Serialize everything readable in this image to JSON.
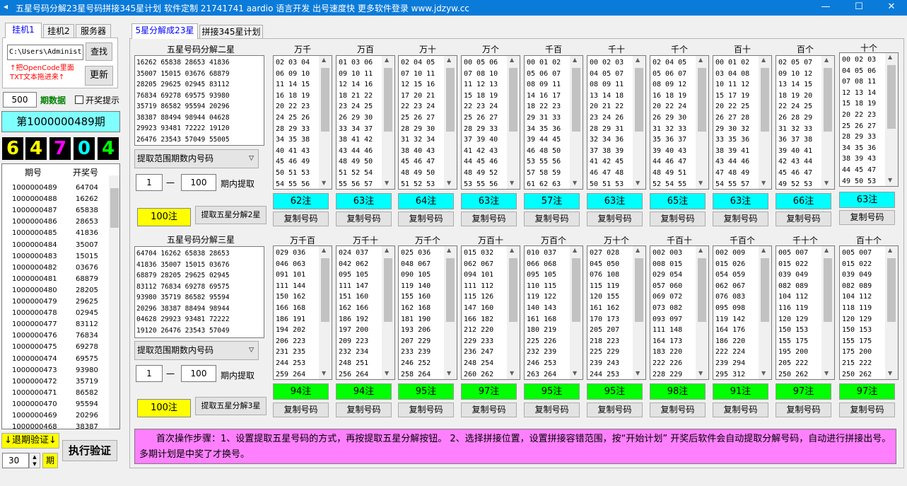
{
  "window": {
    "title": "五星号码分解23星号码拼接345星计划 软件定制 21741741 aardio 语言开发 出号速度快 更多软件登录 www.jdzyw.cc",
    "min": "—",
    "max": "☐",
    "close": "✕",
    "icon": "app-icon"
  },
  "left_tabs": [
    "挂机1",
    "挂机2",
    "服务器"
  ],
  "path_input": "C:\\Users\\Administ",
  "view_btn": "查找",
  "drag_hint_1": "↑把OpenCode里面",
  "drag_hint_2": "TXT文本拖进来↑",
  "refresh_btn": "更新",
  "period_count": "500",
  "period_count_label": "期数据",
  "prize_hint": "开奖提示",
  "current_period": "第1000000489期",
  "balls": [
    "6",
    "4",
    "7",
    "0",
    "4"
  ],
  "ball_colors": [
    "#ffff00",
    "#ffff00",
    "#ff00ff",
    "#00ffff",
    "#00ff00"
  ],
  "history": {
    "headers": [
      "期号",
      "开奖号"
    ],
    "rows": [
      [
        "1000000489",
        "64704"
      ],
      [
        "1000000488",
        "16262"
      ],
      [
        "1000000487",
        "65838"
      ],
      [
        "1000000486",
        "28653"
      ],
      [
        "1000000485",
        "41836"
      ],
      [
        "1000000484",
        "35007"
      ],
      [
        "1000000483",
        "15015"
      ],
      [
        "1000000482",
        "03676"
      ],
      [
        "1000000481",
        "68879"
      ],
      [
        "1000000480",
        "28205"
      ],
      [
        "1000000479",
        "29625"
      ],
      [
        "1000000478",
        "02945"
      ],
      [
        "1000000477",
        "83112"
      ],
      [
        "1000000476",
        "76834"
      ],
      [
        "1000000475",
        "69278"
      ],
      [
        "1000000474",
        "69575"
      ],
      [
        "1000000473",
        "93980"
      ],
      [
        "1000000472",
        "35719"
      ],
      [
        "1000000471",
        "86582"
      ],
      [
        "1000000470",
        "95594"
      ],
      [
        "1000000469",
        "20296"
      ],
      [
        "1000000468",
        "38387"
      ]
    ]
  },
  "verify_step_btn": "↓退期验证↓",
  "verify_value": "30",
  "verify_unit": "期",
  "exec_verify_btn": "执行验证",
  "main_tabs": [
    "5星分解成23星",
    "拼接345星计划"
  ],
  "sec2": {
    "title": "五星号码分解二星",
    "lines": [
      "16262 65838 28653 41836",
      "35007 15015 03676 68879",
      "28205 29625 02945 83112",
      "76834 69278 69575 93980",
      "35719 86582 95594 20296",
      "38387 88494 98944 04628",
      "29923 93481 72222 19120",
      "26476 23543 57049 55005"
    ],
    "mode": "提取范围期数内号码",
    "from": "1",
    "to": "100",
    "sep": "一",
    "range_label": "期内提取",
    "count": "100注",
    "action": "提取五星分解2星",
    "columns": [
      {
        "h": "万千",
        "l": [
          "02 03 04",
          "06 09 10",
          "11 14 15",
          "16 18 19",
          "20 22 23",
          "24 25 26",
          "28 29 33",
          "34 35 38",
          "40 41 43",
          "45 46 49",
          "50 51 53",
          "54 55 56"
        ],
        "c": "62注"
      },
      {
        "h": "万百",
        "l": [
          "01 03 06",
          "09 10 11",
          "12 14 16",
          "18 21 22",
          "23 24 25",
          "26 29 30",
          "33 34 37",
          "38 41 42",
          "43 44 46",
          "48 49 50",
          "51 52 54",
          "55 56 57"
        ],
        "c": "63注"
      },
      {
        "h": "万十",
        "l": [
          "02 04 05",
          "07 10 11",
          "12 15 16",
          "17 20 21",
          "22 23 24",
          "25 26 27",
          "28 29 30",
          "31 32 34",
          "38 40 43",
          "45 46 47",
          "48 49 50",
          "51 52 53"
        ],
        "c": "64注"
      },
      {
        "h": "万个",
        "l": [
          "00 05 06",
          "07 08 10",
          "11 12 13",
          "15 18 19",
          "22 23 24",
          "25 26 27",
          "28 29 33",
          "37 39 40",
          "41 42 43",
          "44 45 46",
          "48 49 52",
          "53 55 56"
        ],
        "c": "63注"
      },
      {
        "h": "千百",
        "l": [
          "00 01 02",
          "05 06 07",
          "08 09 11",
          "14 16 17",
          "18 22 23",
          "29 31 33",
          "34 35 36",
          "39 44 45",
          "46 48 50",
          "53 55 56",
          "57 58 59",
          "61 62 63"
        ],
        "c": "57注"
      },
      {
        "h": "千十",
        "l": [
          "00 02 03",
          "04 05 07",
          "08 09 11",
          "13 14 18",
          "20 21 22",
          "23 24 26",
          "28 29 31",
          "32 34 36",
          "37 38 39",
          "41 42 45",
          "46 47 48",
          "50 51 53"
        ],
        "c": "63注"
      },
      {
        "h": "千个",
        "l": [
          "02 04 05",
          "05 06 07",
          "08 09 12",
          "16 18 19",
          "20 22 24",
          "26 29 30",
          "31 32 33",
          "35 36 37",
          "39 40 43",
          "44 46 47",
          "48 49 51",
          "52 54 55"
        ],
        "c": "65注"
      },
      {
        "h": "百十",
        "l": [
          "00 01 02",
          "03 04 08",
          "10 11 12",
          "15 17 19",
          "20 22 25",
          "26 27 28",
          "29 30 32",
          "33 35 36",
          "38 39 41",
          "43 44 46",
          "47 48 49",
          "54 55 57"
        ],
        "c": "63注"
      },
      {
        "h": "百个",
        "l": [
          "02 05 07",
          "09 10 12",
          "13 14 15",
          "18 19 20",
          "22 24 25",
          "26 28 29",
          "31 32 33",
          "36 37 38",
          "39 40 41",
          "42 43 44",
          "45 46 47",
          "49 52 53"
        ],
        "c": "66注"
      },
      {
        "h": "十个",
        "l": [
          "00 02 03",
          "04 05 06",
          "07 08 11",
          "12 13 14",
          "15 18 19",
          "20 22 23",
          "25 26 27",
          "28 29 33",
          "34 35 36",
          "38 39 43",
          "44 45 47",
          "49 50 53"
        ],
        "c": "63注"
      }
    ]
  },
  "sec3": {
    "title": "五星号码分解三星",
    "lines": [
      "64704 16262 65838 28653",
      "41836 35007 15015 03676",
      "68879 28205 29625 02945",
      "83112 76834 69278 69575",
      "93980 35719 86582 95594",
      "20296 38387 88494 98944",
      "04628 29923 93481 72222",
      "19120 26476 23543 57049"
    ],
    "mode": "提取范围期数内号码",
    "from": "1",
    "to": "100",
    "sep": "一",
    "range_label": "期内提取",
    "count": "100注",
    "action": "提取五星分解3星",
    "columns": [
      {
        "h": "万千百",
        "l": [
          "029 036",
          "046 063",
          "091 101",
          "111 144",
          "150 162",
          "166 168",
          "186 191",
          "194 202",
          "206 223",
          "231 235",
          "244 253",
          "259 264"
        ],
        "c": "94注"
      },
      {
        "h": "万千十",
        "l": [
          "024 037",
          "042 062",
          "095 105",
          "111 147",
          "151 160",
          "162 166",
          "186 192",
          "197 200",
          "209 223",
          "232 234",
          "248 251",
          "256 264"
        ],
        "c": "94注"
      },
      {
        "h": "万千个",
        "l": [
          "025 036",
          "048 067",
          "090 105",
          "119 140",
          "155 160",
          "162 168",
          "181 190",
          "193 206",
          "207 229",
          "233 239",
          "246 252",
          "258 264"
        ],
        "c": "95注"
      },
      {
        "h": "万百十",
        "l": [
          "015 032",
          "062 067",
          "094 101",
          "111 112",
          "115 126",
          "147 160",
          "166 182",
          "212 220",
          "229 233",
          "236 247",
          "248 254",
          "260 262"
        ],
        "c": "97注"
      },
      {
        "h": "万百个",
        "l": [
          "010 037",
          "066 068",
          "095 105",
          "110 115",
          "119 122",
          "140 143",
          "161 168",
          "180 219",
          "225 226",
          "232 239",
          "246 253",
          "263 264"
        ],
        "c": "95注"
      },
      {
        "h": "万十个",
        "l": [
          "027 028",
          "045 050",
          "076 108",
          "115 119",
          "120 155",
          "161 162",
          "170 173",
          "205 207",
          "218 223",
          "225 229",
          "239 243",
          "244 253"
        ],
        "c": "95注"
      },
      {
        "h": "千百十",
        "l": [
          "002 003",
          "008 015",
          "029 054",
          "057 060",
          "069 072",
          "073 082",
          "093 097",
          "111 148",
          "164 173",
          "183 220",
          "222 226",
          "228 229"
        ],
        "c": "98注"
      },
      {
        "h": "千百个",
        "l": [
          "002 009",
          "015 026",
          "054 059",
          "062 067",
          "076 083",
          "095 098",
          "119 142",
          "164 176",
          "186 220",
          "222 224",
          "239 294",
          "295 312"
        ],
        "c": "91注"
      },
      {
        "h": "千十个",
        "l": [
          "005 007",
          "015 022",
          "039 049",
          "082 089",
          "104 112",
          "116 119",
          "120 129",
          "150 153",
          "155 175",
          "195 200",
          "205 222",
          "250 262"
        ],
        "c": "97注"
      },
      {
        "h": "百十个",
        "l": [
          "005 007",
          "015 022",
          "039 049",
          "082 089",
          "104 112",
          "118 119",
          "120 129",
          "150 153",
          "155 175",
          "175 200",
          "215 222",
          "250 262"
        ],
        "c": "97注"
      }
    ]
  },
  "copy_label": "复制号码",
  "instructions": "首次操作步骤：1、设置提取五星号码的方式，再按提取五星分解按钮。 2、选择拼接位置，设置拼接容错范围，按“开始计划” 开奖后软件会自动提取分解号码，自动进行拼接出号。多期计划是中奖了才换号。",
  "colors": {
    "title": "#0b7bd9",
    "sec2_count": "#00ffff",
    "sec3_count": "#00ff00",
    "action_count": "#ffff00",
    "instructions_bg": "#ff80ff"
  }
}
